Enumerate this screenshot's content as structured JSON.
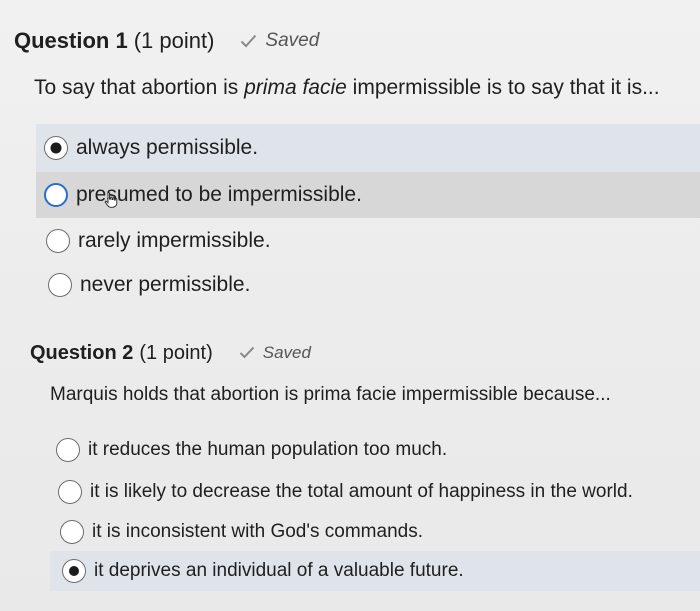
{
  "question1": {
    "title": "Question 1",
    "points": "(1 point)",
    "saved_label": "Saved",
    "prompt_before": "To say that abortion is ",
    "prompt_italic": "prima facie",
    "prompt_after": " impermissible is to say that it is...",
    "options": [
      {
        "label": "always permissible.",
        "selected": true
      },
      {
        "label": "presumed to be impermissible.",
        "selected": false
      },
      {
        "label": "rarely impermissible.",
        "selected": false
      },
      {
        "label": "never permissible.",
        "selected": false
      }
    ]
  },
  "question2": {
    "title": "Question 2",
    "points": "(1 point)",
    "saved_label": "Saved",
    "prompt": "Marquis holds that abortion is prima facie impermissible because...",
    "options": [
      {
        "label": "it reduces the human population too much.",
        "selected": false
      },
      {
        "label": "it is likely to decrease the total amount of happiness in the world.",
        "selected": false
      },
      {
        "label": "it is inconsistent with God's commands.",
        "selected": false
      },
      {
        "label": "it deprives an individual of a valuable future.",
        "selected": true
      }
    ]
  },
  "icons": {
    "saved_check": "check-icon",
    "pointer": "hand-cursor-icon"
  },
  "colors": {
    "selected_row": "#dfe4ea",
    "hover_row": "#d7d7d7",
    "radio_fill": "#1b1b1b"
  }
}
